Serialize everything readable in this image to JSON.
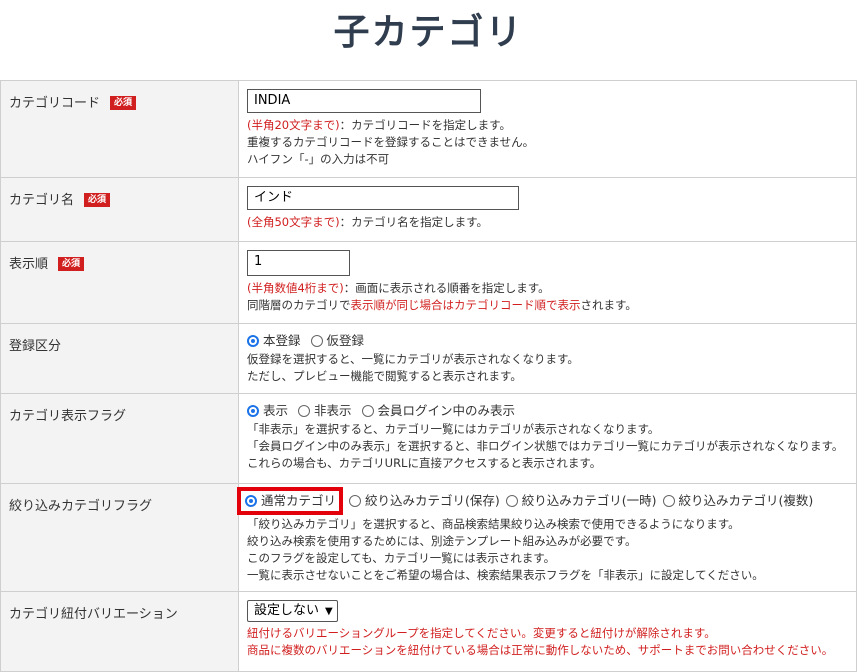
{
  "page": {
    "title": "子カテゴリ"
  },
  "required_label": "必須",
  "rows": {
    "code": {
      "label": "カテゴリコード",
      "value": "INDIA",
      "note_red": "(半角20文字まで)",
      "note_rest": "：カテゴリコードを指定します。",
      "line2": "重複するカテゴリコードを登録することはできません。",
      "line3": "ハイフン「-」の入力は不可"
    },
    "name": {
      "label": "カテゴリ名",
      "value": "インド",
      "note_red": "(全角50文字まで)",
      "note_rest": "：カテゴリ名を指定します。"
    },
    "order": {
      "label": "表示順",
      "value": "1",
      "note_red": "(半角数値4桁まで)",
      "note_rest": "：画面に表示される順番を指定します。",
      "line2_a": "同階層のカテゴリで",
      "line2_red": "表示順が同じ場合はカテゴリコード順で表示",
      "line2_b": "されます。"
    },
    "registration": {
      "label": "登録区分",
      "options": [
        "本登録",
        "仮登録"
      ],
      "line1": "仮登録を選択すると、一覧にカテゴリが表示されなくなります。",
      "line2": "ただし、プレビュー機能で閲覧すると表示されます。"
    },
    "display": {
      "label": "カテゴリ表示フラグ",
      "options": [
        "表示",
        "非表示",
        "会員ログイン中のみ表示"
      ],
      "line1": "「非表示」を選択すると、カテゴリ一覧にはカテゴリが表示されなくなります。",
      "line2": "「会員ログイン中のみ表示」を選択すると、非ログイン状態ではカテゴリ一覧にカテゴリが表示されなくなります。",
      "line3": "これらの場合も、カテゴリURLに直接アクセスすると表示されます。"
    },
    "filter": {
      "label": "絞り込みカテゴリフラグ",
      "options": [
        "通常カテゴリ",
        "絞り込みカテゴリ(保存)",
        "絞り込みカテゴリ(一時)",
        "絞り込みカテゴリ(複数)"
      ],
      "line1": "「絞り込みカテゴリ」を選択すると、商品検索結果絞り込み検索で使用できるようになります。",
      "line2": "絞り込み検索を使用するためには、別途テンプレート組み込みが必要です。",
      "line3": "このフラグを設定しても、カテゴリ一覧には表示されます。",
      "line4": "一覧に表示させないことをご希望の場合は、検索結果表示フラグを「非表示」に設定してください。"
    },
    "variation": {
      "label": "カテゴリ紐付バリエーション",
      "select_value": "設定しない",
      "line1": "紐付けるバリエーショングループを指定してください。変更すると紐付けが解除されます。",
      "line2": "商品に複数のバリエーションを紐付けている場合は正常に動作しないため、サポートまでお問い合わせください。"
    }
  }
}
